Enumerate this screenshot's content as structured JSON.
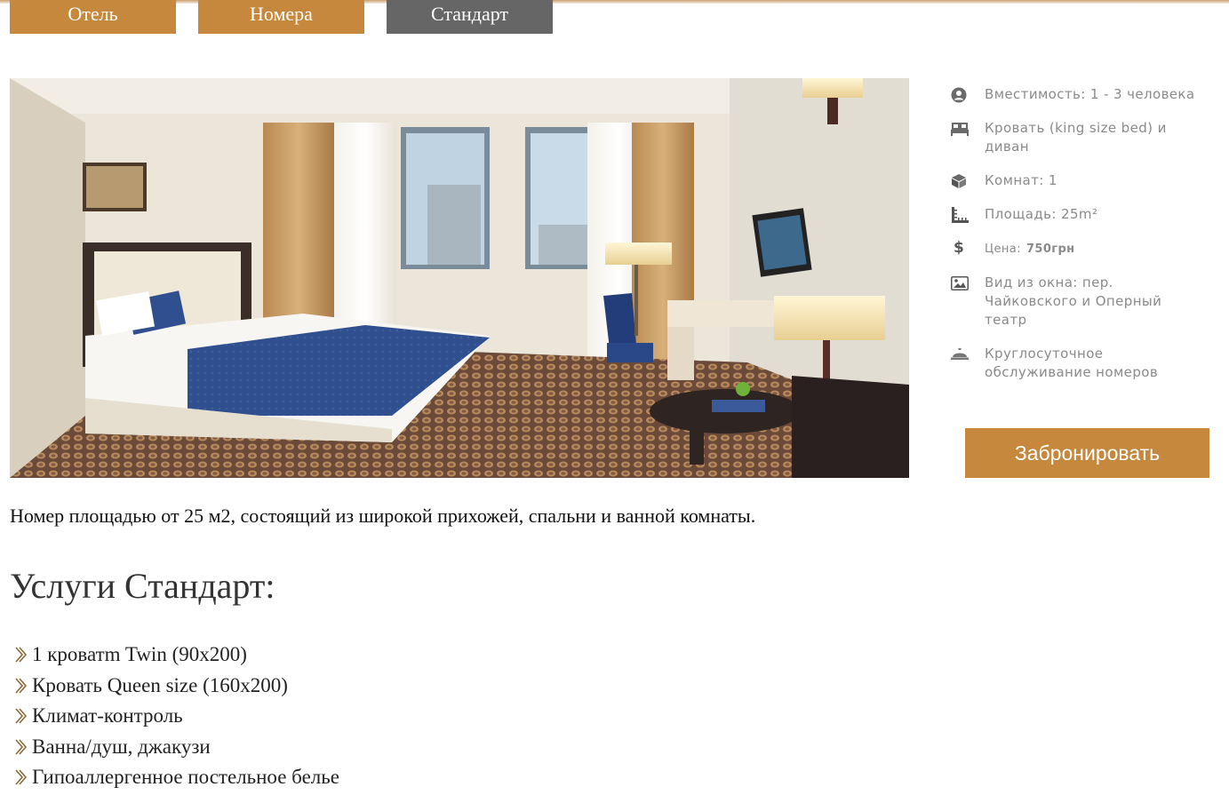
{
  "breadcrumb": {
    "items": [
      {
        "label": "Отель"
      },
      {
        "label": "Номера"
      },
      {
        "label": "Стандарт"
      }
    ]
  },
  "colors": {
    "accent": "#c5883c",
    "active_tab": "#666666",
    "feature_text": "#8a8a8a"
  },
  "features": [
    {
      "icon": "user-icon",
      "text": "Вместимость: 1 - 3 человека"
    },
    {
      "icon": "bed-icon",
      "text": "Кровать (king size bed) и диван"
    },
    {
      "icon": "cube-icon",
      "text": "Комнат: 1"
    },
    {
      "icon": "ruler-icon",
      "text": "Площадь: 25m²"
    },
    {
      "icon": "dollar-icon",
      "label": "Цена:",
      "value": "750грн"
    },
    {
      "icon": "image-icon",
      "text": "Вид из окна: пер. Чайковского и Оперный театр"
    },
    {
      "icon": "room-service-icon",
      "text": "Круглосуточное обслуживание номеров"
    }
  ],
  "book_button": {
    "label": "Забронировать"
  },
  "description": "Номер площадью от 25 м2, состоящий из широкой прихожей, спальни и ванной комнаты.",
  "services": {
    "title": "Услуги Стандарт:",
    "items": [
      "1 кроватm Twin (90x200)",
      "Кровать Queen size (160x200)",
      "Климат-контроль",
      "Ванна/душ, джакузи",
      "Гипоаллергенное постельное белье"
    ]
  }
}
